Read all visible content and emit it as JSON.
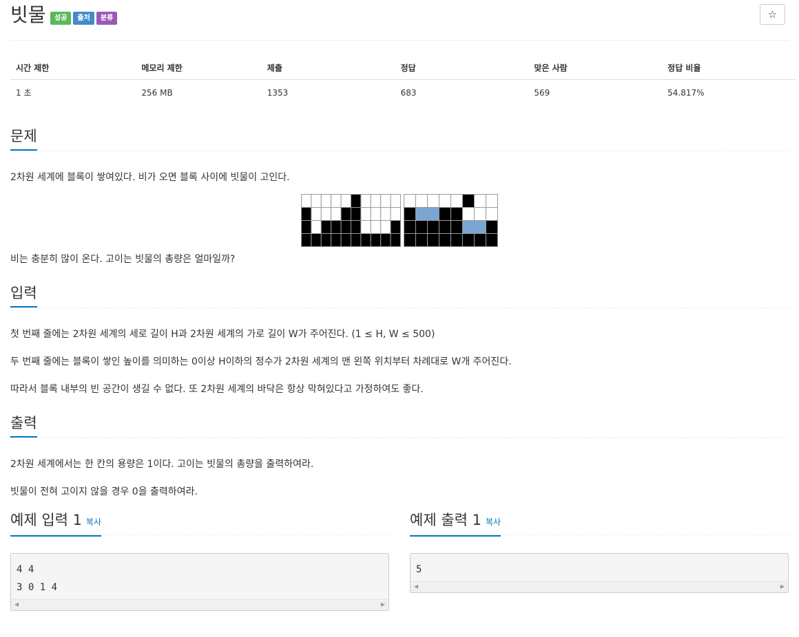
{
  "problem": {
    "title": "빗물",
    "labels": [
      {
        "text": "성공",
        "color": "#5cb85c"
      },
      {
        "text": "출처",
        "color": "#428bca"
      },
      {
        "text": "분류",
        "color": "#9b59b6"
      }
    ],
    "star": "☆"
  },
  "info_table": {
    "headers": [
      "시간 제한",
      "메모리 제한",
      "제출",
      "정답",
      "맞은 사람",
      "정답 비율"
    ],
    "values": [
      "1 초",
      "256 MB",
      "1353",
      "683",
      "569",
      "54.817%"
    ]
  },
  "sections": {
    "description": {
      "title": "문제",
      "p1": "2차원 세계에 블록이 쌓여있다. 비가 오면 블록 사이에 빗물이 고인다.",
      "p2": "비는 충분히 많이 온다. 고이는 빗물의 총량은 얼마일까?"
    },
    "input": {
      "title": "입력",
      "p1": "첫 번째 줄에는 2차원 세계의 세로 길이 H과 2차원 세계의 가로 길이 W가 주어진다. (1 ≤ H, W ≤ 500)",
      "p2": "두 번째 줄에는 블록이 쌓인 높이를 의미하는 0이상 H이하의 정수가 2차원 세계의 맨 왼쪽 위치부터 차례대로 W개 주어진다.",
      "p3": "따라서 블록 내부의 빈 공간이 생길 수 없다. 또 2차원 세계의 바닥은 항상 막혀있다고 가정하여도 좋다."
    },
    "output": {
      "title": "출력",
      "p1": "2차원 세계에서는 한 칸의 용량은 1이다. 고이는 빗물의 총량을 출력하여라.",
      "p2": "빗물이 전혀 고이지 않을 경우 0을 출력하여라."
    }
  },
  "samples": {
    "input": {
      "title": "예제 입력 1",
      "copy": "복사",
      "lines": [
        "4 4",
        "3 0 1 4"
      ]
    },
    "output": {
      "title": "예제 출력 1",
      "copy": "복사",
      "lines": [
        "5"
      ]
    }
  },
  "figure": {
    "grid_a": [
      "0000010000",
      "1000110000",
      "1011110001",
      "1111111111"
    ],
    "grid_b": [
      "00000100",
      "12211000",
      "11111221",
      "11111111"
    ],
    "colors": {
      "block": "#000000",
      "empty": "#ffffff",
      "water": "#7aa6d6",
      "grid_line": "#999999"
    }
  }
}
